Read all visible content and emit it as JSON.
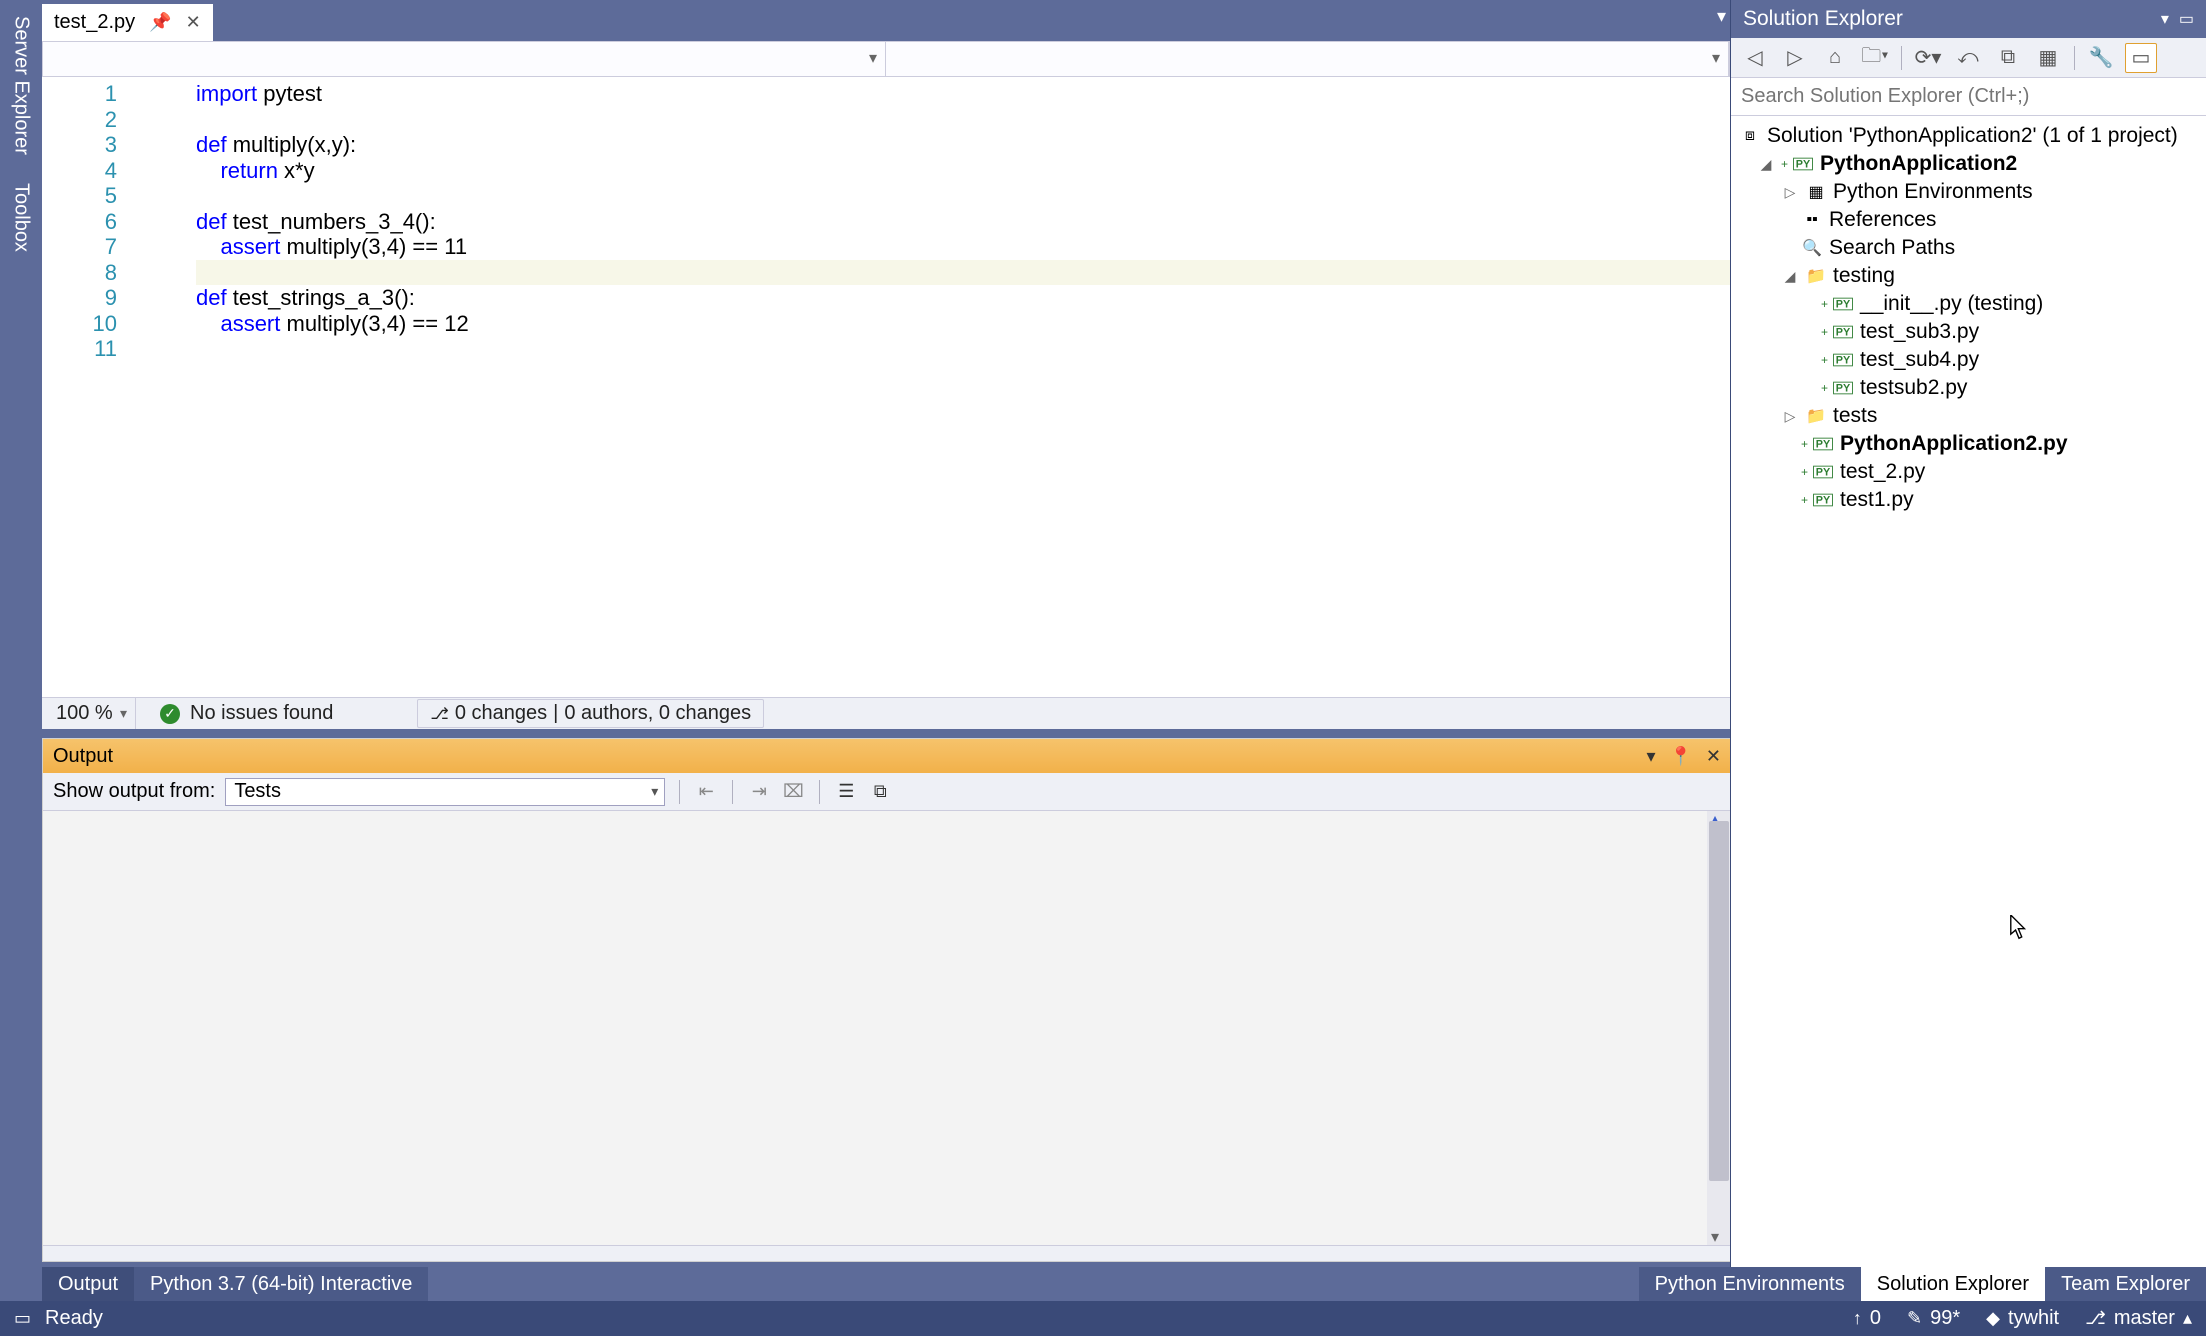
{
  "left_rail": {
    "tabs": [
      "Server Explorer",
      "Toolbox"
    ]
  },
  "doc_tabs": {
    "active": {
      "name": "test_2.py"
    }
  },
  "editor": {
    "zoom": "100 %",
    "issues": "No issues found",
    "changes": "0 changes",
    "authors": "0 authors, 0 changes",
    "lines": [
      {
        "n": "1",
        "html": "<span class='kw'>import</span> pytest"
      },
      {
        "n": "2",
        "html": ""
      },
      {
        "n": "3",
        "html": "<span class='kw'>def</span> multiply(x,y):"
      },
      {
        "n": "4",
        "html": "    <span class='kw'>return</span> x*y"
      },
      {
        "n": "5",
        "html": ""
      },
      {
        "n": "6",
        "html": "<span class='kw'>def</span> test_numbers_3_4():"
      },
      {
        "n": "7",
        "html": "    <span class='kw'>assert</span> multiply(3,4) == 11"
      },
      {
        "n": "8",
        "html": ""
      },
      {
        "n": "9",
        "html": "<span class='kw'>def</span> test_strings_a_3():"
      },
      {
        "n": "10",
        "html": "    <span class='kw'>assert</span> multiply(3,4) == 12"
      },
      {
        "n": "11",
        "html": ""
      }
    ]
  },
  "output": {
    "title": "Output",
    "from_label": "Show output from:",
    "from_value": "Tests"
  },
  "bottom_tabs": {
    "items": [
      "Output",
      "Python 3.7 (64-bit) Interactive"
    ],
    "active": 0
  },
  "right_tabs": {
    "items": [
      "Python Environments",
      "Solution Explorer",
      "Team Explorer"
    ],
    "active": 1
  },
  "sln": {
    "title": "Solution Explorer",
    "search_placeholder": "Search Solution Explorer (Ctrl+;)",
    "root": "Solution 'PythonApplication2' (1 of 1 project)",
    "project": "PythonApplication2",
    "nodes": {
      "env": "Python Environments",
      "refs": "References",
      "search_paths": "Search Paths",
      "testing": "testing",
      "testing_items": [
        "__init__.py (testing)",
        "test_sub3.py",
        "test_sub4.py",
        "testsub2.py"
      ],
      "tests": "tests",
      "files": [
        "PythonApplication2.py",
        "test_2.py",
        "test1.py"
      ]
    }
  },
  "status": {
    "ready": "Ready",
    "upload_count": "0",
    "pencil_count": "99*",
    "user": "tywhit",
    "branch": "master"
  }
}
